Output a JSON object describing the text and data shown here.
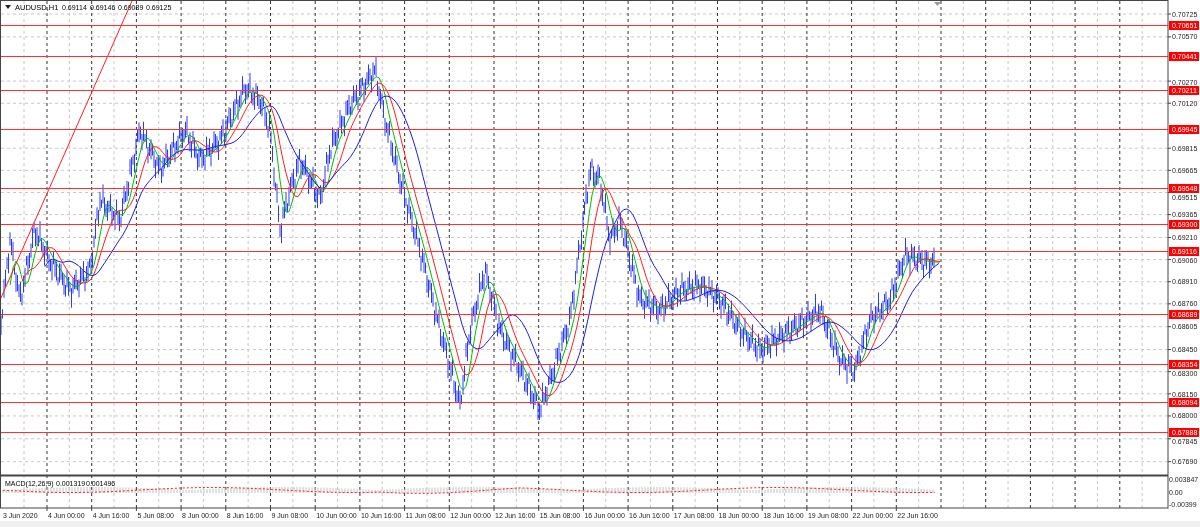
{
  "header": {
    "symbol": "AUDUSD,H1",
    "values": [
      "0.69114",
      "0.69146",
      "0.69089",
      "0.69125"
    ]
  },
  "price_axis": [
    "0.70725",
    "0.70570",
    "0.70270",
    "0.70120",
    "0.69815",
    "0.69665",
    "0.69515",
    "0.69365",
    "0.69210",
    "0.69060",
    "0.68910",
    "0.68760",
    "0.68605",
    "0.68450",
    "0.68300",
    "0.68150",
    "0.68000",
    "0.67845",
    "0.67690"
  ],
  "levels": [
    {
      "price": "0.70651"
    },
    {
      "price": "0.70441"
    },
    {
      "price": "0.70211"
    },
    {
      "price": "0.69945"
    },
    {
      "price": "0.69548"
    },
    {
      "price": "0.69300"
    },
    {
      "price": "0.69116"
    },
    {
      "price": "0.68689"
    },
    {
      "price": "0.68354"
    },
    {
      "price": "0.68094"
    },
    {
      "price": "0.67888"
    }
  ],
  "time_axis": [
    "3 Jun 2020",
    "4 Jun 00:00",
    "4 Jun 16:00",
    "5 Jun 08:00",
    "8 Jun 00:00",
    "8 Jun 16:00",
    "9 Jun 08:00",
    "10 Jun 00:00",
    "10 Jun 16:00",
    "11 Jun 08:00",
    "12 Jun 00:00",
    "12 Jun 16:00",
    "15 Jun 08:00",
    "16 Jun 00:00",
    "16 Jun 16:00",
    "17 Jun 08:00",
    "18 Jun 00:00",
    "18 Jun 16:00",
    "19 Jun 08:00",
    "22 Jun 00:00",
    "22 Jun 16:00"
  ],
  "indicator": {
    "label": "MACD(12,26,9)",
    "values": [
      "0.001319",
      "0.001496"
    ],
    "axis": [
      "0.003847",
      "0.00",
      "-0.00399"
    ]
  }
}
